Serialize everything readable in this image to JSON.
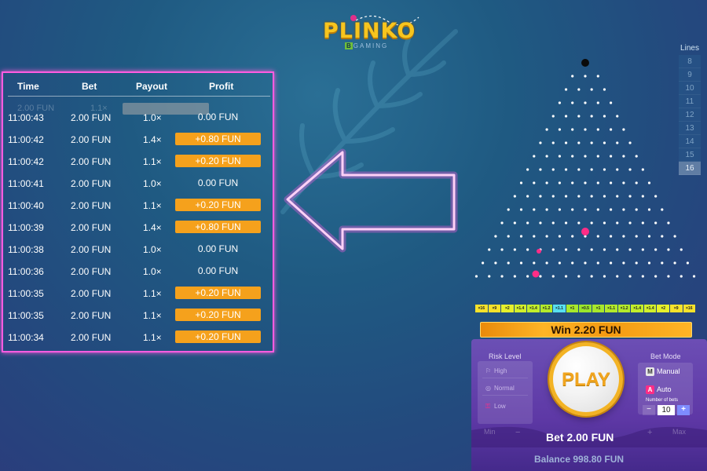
{
  "logo": {
    "title": "PLINKO",
    "brand_badge": "B",
    "brand_rest": "GAMING"
  },
  "history": {
    "headers": {
      "time": "Time",
      "bet": "Bet",
      "payout": "Payout",
      "profit": "Profit"
    },
    "ghost_row": {
      "bet": "2.00 FUN",
      "payout": "1.1×"
    },
    "rows": [
      {
        "time": "11:00:43",
        "bet": "2.00 FUN",
        "payout": "1.0×",
        "profit": "0.00 FUN",
        "win": false
      },
      {
        "time": "11:00:42",
        "bet": "2.00 FUN",
        "payout": "1.4×",
        "profit": "+0.80 FUN",
        "win": true
      },
      {
        "time": "11:00:42",
        "bet": "2.00 FUN",
        "payout": "1.1×",
        "profit": "+0.20 FUN",
        "win": true
      },
      {
        "time": "11:00:41",
        "bet": "2.00 FUN",
        "payout": "1.0×",
        "profit": "0.00 FUN",
        "win": false
      },
      {
        "time": "11:00:40",
        "bet": "2.00 FUN",
        "payout": "1.1×",
        "profit": "+0.20 FUN",
        "win": true
      },
      {
        "time": "11:00:39",
        "bet": "2.00 FUN",
        "payout": "1.4×",
        "profit": "+0.80 FUN",
        "win": true
      },
      {
        "time": "11:00:38",
        "bet": "2.00 FUN",
        "payout": "1.0×",
        "profit": "0.00 FUN",
        "win": false
      },
      {
        "time": "11:00:36",
        "bet": "2.00 FUN",
        "payout": "1.0×",
        "profit": "0.00 FUN",
        "win": false
      },
      {
        "time": "11:00:35",
        "bet": "2.00 FUN",
        "payout": "1.1×",
        "profit": "+0.20 FUN",
        "win": true
      },
      {
        "time": "11:00:35",
        "bet": "2.00 FUN",
        "payout": "1.1×",
        "profit": "+0.20 FUN",
        "win": true
      },
      {
        "time": "11:00:34",
        "bet": "2.00 FUN",
        "payout": "1.1×",
        "profit": "+0.20 FUN",
        "win": true
      }
    ]
  },
  "lines": {
    "title": "Lines",
    "options": [
      "8",
      "9",
      "10",
      "11",
      "12",
      "13",
      "14",
      "15",
      "16"
    ],
    "selected": "16"
  },
  "multipliers": [
    "×16",
    "×9",
    "×2",
    "×1.4",
    "×1.4",
    "×1.2",
    "×1.1",
    "×1",
    "×0.5",
    "×1",
    "×1.1",
    "×1.2",
    "×1.4",
    "×1.4",
    "×2",
    "×9",
    "×16"
  ],
  "multiplier_colors": [
    "#f6e22b",
    "#f6e22b",
    "#e6f02b",
    "#d2f02b",
    "#c2ee2b",
    "#b3ea2b",
    "#57e0f0",
    "#a8e82b",
    "#9ae62b",
    "#a8e82b",
    "#b3ea2b",
    "#b3ea2b",
    "#c2ee2b",
    "#d2f02b",
    "#e6f02b",
    "#f6e22b",
    "#f6e22b"
  ],
  "win_banner": "Win 2.20 FUN",
  "risk": {
    "title": "Risk Level",
    "high": "High",
    "normal": "Normal",
    "low": "Low"
  },
  "bet_mode": {
    "title": "Bet Mode",
    "manual_key": "M",
    "manual": "Manual",
    "auto_key": "A",
    "auto": "Auto",
    "number_label": "Number of bets",
    "number_value": "10",
    "minus": "−",
    "plus": "+"
  },
  "play_label": "PLAY",
  "bet_controls": {
    "min": "Min",
    "max": "Max",
    "minus": "−",
    "plus": "+",
    "bet_label": "Bet 2.00 FUN"
  },
  "balance": "Balance 998.80 FUN"
}
